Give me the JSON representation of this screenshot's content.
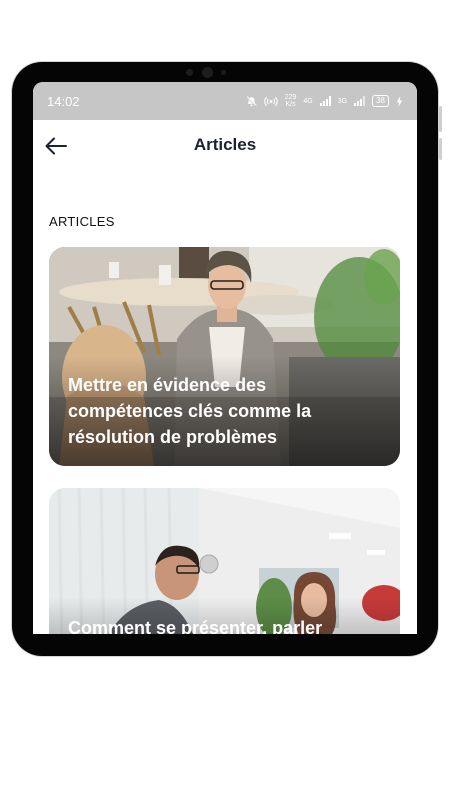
{
  "status_bar": {
    "time": "14:02",
    "network_speed_top": "229",
    "network_speed_bottom": "K/s",
    "sim1_label": "4G",
    "sim2_label": "3G",
    "battery": "38",
    "icons": [
      "mute-icon",
      "hotspot-icon",
      "signal-icon",
      "signal-icon",
      "battery-icon",
      "charging-icon"
    ]
  },
  "header": {
    "title": "Articles"
  },
  "section": {
    "heading": "ARTICLES"
  },
  "articles": [
    {
      "title": "Mettre en évidence des compétences clés comme la résolution de problèmes"
    },
    {
      "title": "Comment se présenter, parler"
    }
  ]
}
